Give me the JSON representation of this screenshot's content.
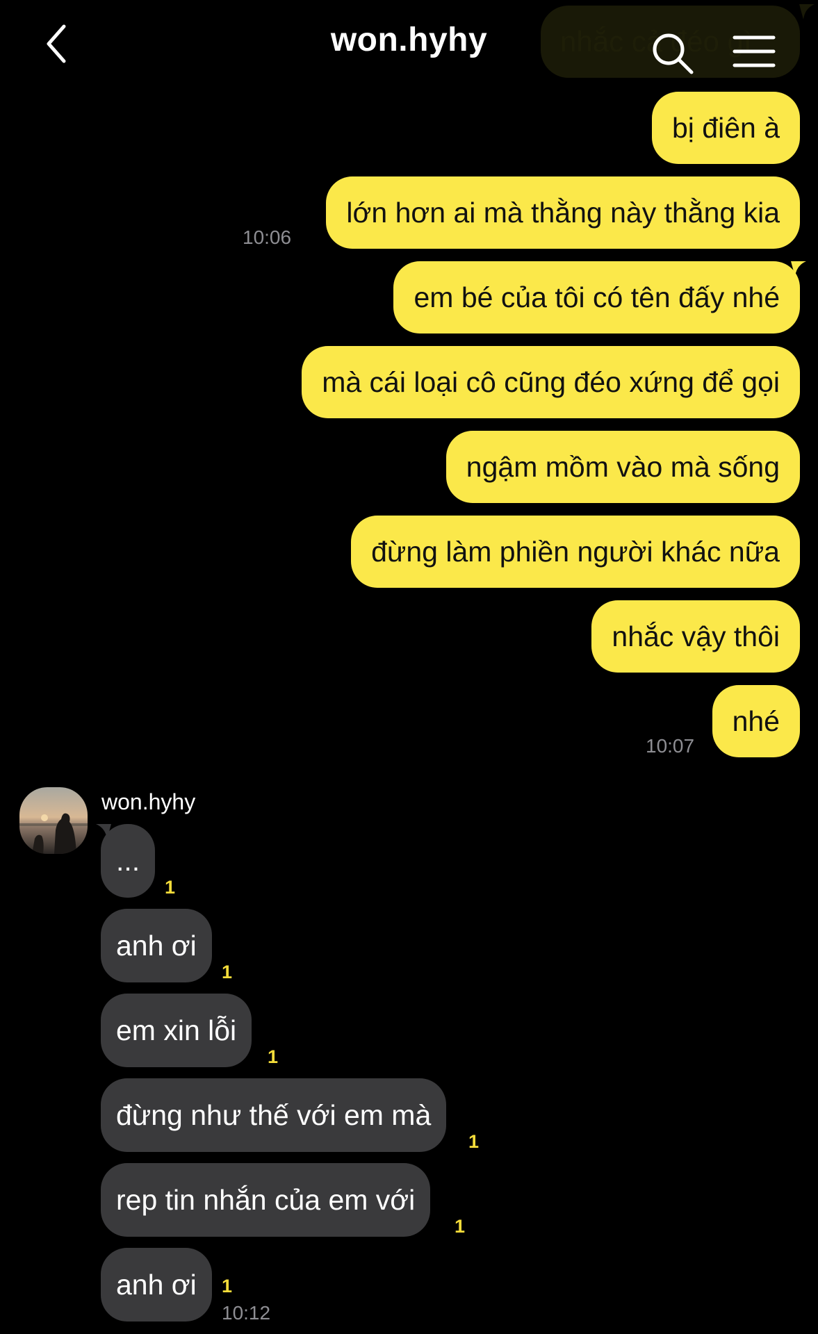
{
  "header": {
    "title": "won.hyhy",
    "back_icon": "chevron-left-icon",
    "search_icon": "search-icon",
    "menu_icon": "hamburger-menu-icon"
  },
  "colors": {
    "background": "#000000",
    "outgoing_bubble": "#fbe84a",
    "incoming_bubble": "#3a3a3c",
    "unread_count": "#f4dc3a",
    "timestamp": "#8e8e93"
  },
  "partial_message": "nhắc cả đéo gì",
  "outgoing": [
    {
      "text": "bị điên à"
    },
    {
      "text": "lớn hơn ai mà thằng này thằng kia",
      "time": "10:06"
    },
    {
      "text": "em bé của tôi có tên đấy nhé"
    },
    {
      "text": "mà cái loại cô cũng đéo xứng để gọi"
    },
    {
      "text": "ngậm mồm vào mà sống"
    },
    {
      "text": "đừng làm phiền người khác nữa"
    },
    {
      "text": "nhắc vậy thôi"
    },
    {
      "text": "nhé",
      "time": "10:07"
    }
  ],
  "incoming_group": {
    "sender": "won.hyhy",
    "avatar": "avatar-photo-sunset-beach",
    "messages": [
      {
        "text": "...",
        "unread": "1"
      },
      {
        "text": "anh ơi",
        "unread": "1"
      },
      {
        "text": "em xin lỗi",
        "unread": "1"
      },
      {
        "text": "đừng như thế với em mà",
        "unread": "1"
      },
      {
        "text": "rep tin nhắn của em với",
        "unread": "1"
      },
      {
        "text": "anh ơi",
        "unread": "1",
        "time": "10:12"
      }
    ]
  }
}
